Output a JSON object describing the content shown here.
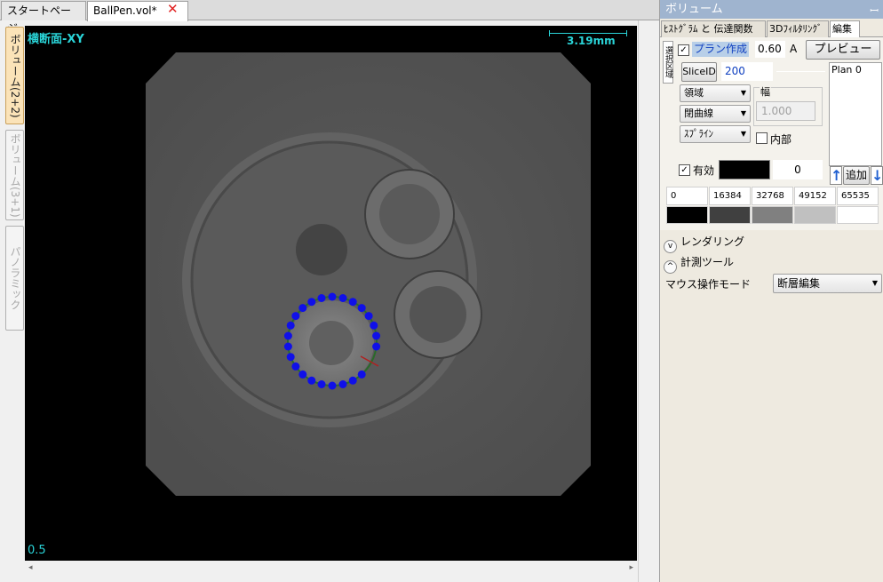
{
  "tabs": {
    "start": "スタートページ",
    "document": "BallPen.vol*"
  },
  "vertical_tabs": [
    "ボリューム(2+2)",
    "ボリューム(3+1)",
    "パノラミック"
  ],
  "viewport": {
    "title": "横断面-XY",
    "scale": "3.19mm",
    "zoom": "0.5",
    "point_color": "#1010e8",
    "label_color": "#2ad4d8"
  },
  "panel": {
    "title": "ボリューム",
    "pin_icon": "pin-icon",
    "tabs": [
      "ﾋｽﾄｸﾞﾗﾑ と 伝達関数",
      "3Dﾌｨﾙﾀﾘﾝｸﾞ",
      "編集"
    ],
    "side_tab": "選択区域",
    "plan_checked": true,
    "plan_label": "プラン作成",
    "opacity": "0.60",
    "opacity_unit": "A",
    "preview": "プレビュー",
    "slice_id_button": "SliceID",
    "slice_id": "200",
    "plans": [
      "Plan 0"
    ],
    "region": "領域",
    "curve": "閉曲線",
    "spline": "ｽﾌﾟﾗｲﾝ",
    "width_label": "幅",
    "width_value": "1.000",
    "inner_label": "内部",
    "valid_checked": true,
    "valid_label": "有効",
    "color_value": "0",
    "add": "追加",
    "gradient_values": [
      "0",
      "16384",
      "32768",
      "49152",
      "65535"
    ],
    "gradient_colors": [
      "#000000",
      "#404040",
      "#808080",
      "#c0c0c0",
      "#ffffff"
    ]
  },
  "sections": {
    "rendering": "レンダリング",
    "measure": "計測ツール",
    "mouse_mode_label": "マウス操作モード",
    "mouse_mode": "断層編集"
  }
}
